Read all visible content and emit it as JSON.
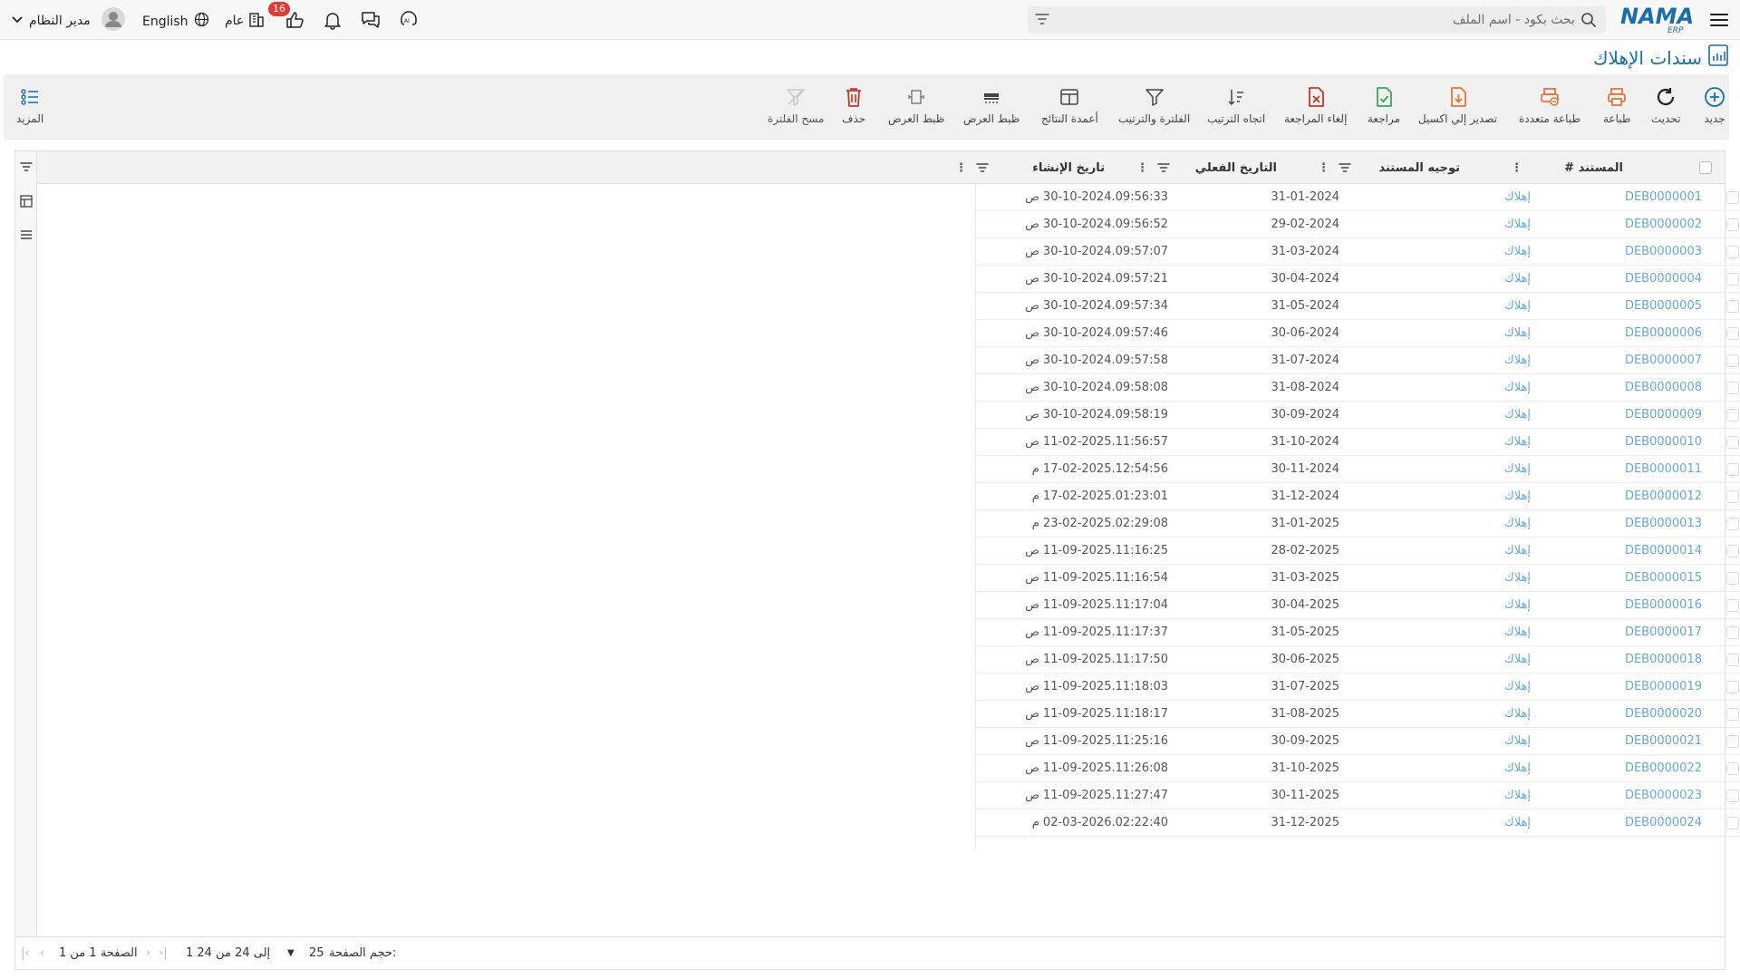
{
  "header": {
    "logo_text": "NAMA",
    "logo_sub": "ERP",
    "search_placeholder": "بحث بكود - اسم الملف",
    "notification_badge": "16",
    "branch_label": "عام",
    "language_label": "English",
    "user_name": "مدير النظام"
  },
  "page": {
    "title": "سندات الإهلاك"
  },
  "toolbar": {
    "new": "جديد",
    "refresh": "تحديث",
    "print": "طباعة",
    "multi_print": "طباعة متعددة",
    "export_excel": "تصدير إلي اكسيل",
    "review": "مراجعة",
    "cancel_review": "إلغاء المراجعة",
    "sort_direction": "اتجاه الترتيب",
    "filter_sort": "الفلترة والترتيب",
    "result_columns": "أعمدة النتائج",
    "view_settings_1": "ظبط العرض",
    "view_settings_2": "ظبط العرض",
    "delete": "حذف",
    "clear_filter": "مسح الفلترة",
    "more": "المزيد"
  },
  "grid": {
    "columns": {
      "document": "# المستند",
      "direction": "توجيه المستند",
      "actual_date": "التاريخ الفعلي",
      "created_at": "تاريخ الإنشاء"
    },
    "rows": [
      {
        "doc": "DEB0000001",
        "dir": "إهلاك",
        "actual": "31-01-2024",
        "created": "30-10-2024.09:56:33 ص"
      },
      {
        "doc": "DEB0000002",
        "dir": "إهلاك",
        "actual": "29-02-2024",
        "created": "30-10-2024.09:56:52 ص"
      },
      {
        "doc": "DEB0000003",
        "dir": "إهلاك",
        "actual": "31-03-2024",
        "created": "30-10-2024.09:57:07 ص"
      },
      {
        "doc": "DEB0000004",
        "dir": "إهلاك",
        "actual": "30-04-2024",
        "created": "30-10-2024.09:57:21 ص"
      },
      {
        "doc": "DEB0000005",
        "dir": "إهلاك",
        "actual": "31-05-2024",
        "created": "30-10-2024.09:57:34 ص"
      },
      {
        "doc": "DEB0000006",
        "dir": "إهلاك",
        "actual": "30-06-2024",
        "created": "30-10-2024.09:57:46 ص"
      },
      {
        "doc": "DEB0000007",
        "dir": "إهلاك",
        "actual": "31-07-2024",
        "created": "30-10-2024.09:57:58 ص"
      },
      {
        "doc": "DEB0000008",
        "dir": "إهلاك",
        "actual": "31-08-2024",
        "created": "30-10-2024.09:58:08 ص"
      },
      {
        "doc": "DEB0000009",
        "dir": "إهلاك",
        "actual": "30-09-2024",
        "created": "30-10-2024.09:58:19 ص"
      },
      {
        "doc": "DEB0000010",
        "dir": "إهلاك",
        "actual": "31-10-2024",
        "created": "11-02-2025.11:56:57 ص"
      },
      {
        "doc": "DEB0000011",
        "dir": "إهلاك",
        "actual": "30-11-2024",
        "created": "17-02-2025.12:54:56 م"
      },
      {
        "doc": "DEB0000012",
        "dir": "إهلاك",
        "actual": "31-12-2024",
        "created": "17-02-2025.01:23:01 م"
      },
      {
        "doc": "DEB0000013",
        "dir": "إهلاك",
        "actual": "31-01-2025",
        "created": "23-02-2025.02:29:08 م"
      },
      {
        "doc": "DEB0000014",
        "dir": "إهلاك",
        "actual": "28-02-2025",
        "created": "11-09-2025.11:16:25 ص"
      },
      {
        "doc": "DEB0000015",
        "dir": "إهلاك",
        "actual": "31-03-2025",
        "created": "11-09-2025.11:16:54 ص"
      },
      {
        "doc": "DEB0000016",
        "dir": "إهلاك",
        "actual": "30-04-2025",
        "created": "11-09-2025.11:17:04 ص"
      },
      {
        "doc": "DEB0000017",
        "dir": "إهلاك",
        "actual": "31-05-2025",
        "created": "11-09-2025.11:17:37 ص"
      },
      {
        "doc": "DEB0000018",
        "dir": "إهلاك",
        "actual": "30-06-2025",
        "created": "11-09-2025.11:17:50 ص"
      },
      {
        "doc": "DEB0000019",
        "dir": "إهلاك",
        "actual": "31-07-2025",
        "created": "11-09-2025.11:18:03 ص"
      },
      {
        "doc": "DEB0000020",
        "dir": "إهلاك",
        "actual": "31-08-2025",
        "created": "11-09-2025.11:18:17 ص"
      },
      {
        "doc": "DEB0000021",
        "dir": "إهلاك",
        "actual": "30-09-2025",
        "created": "11-09-2025.11:25:16 ص"
      },
      {
        "doc": "DEB0000022",
        "dir": "إهلاك",
        "actual": "31-10-2025",
        "created": "11-09-2025.11:26:08 ص"
      },
      {
        "doc": "DEB0000023",
        "dir": "إهلاك",
        "actual": "30-11-2025",
        "created": "11-09-2025.11:27:47 ص"
      },
      {
        "doc": "DEB0000024",
        "dir": "إهلاك",
        "actual": "31-12-2025",
        "created": "02-03-2026.02:22:40 م"
      }
    ]
  },
  "pagination": {
    "page_size_label": "حجم الصفحة:",
    "page_size": "25",
    "range_text": "1 إلى 24 من 24",
    "page_text": "الصفحة 1 من 1"
  },
  "colors": {
    "primary": "#1a6ea8",
    "link": "#6aa7d6",
    "orange": "#e8743b",
    "green": "#3aa757",
    "red": "#c0392b",
    "badge": "#e53935"
  }
}
